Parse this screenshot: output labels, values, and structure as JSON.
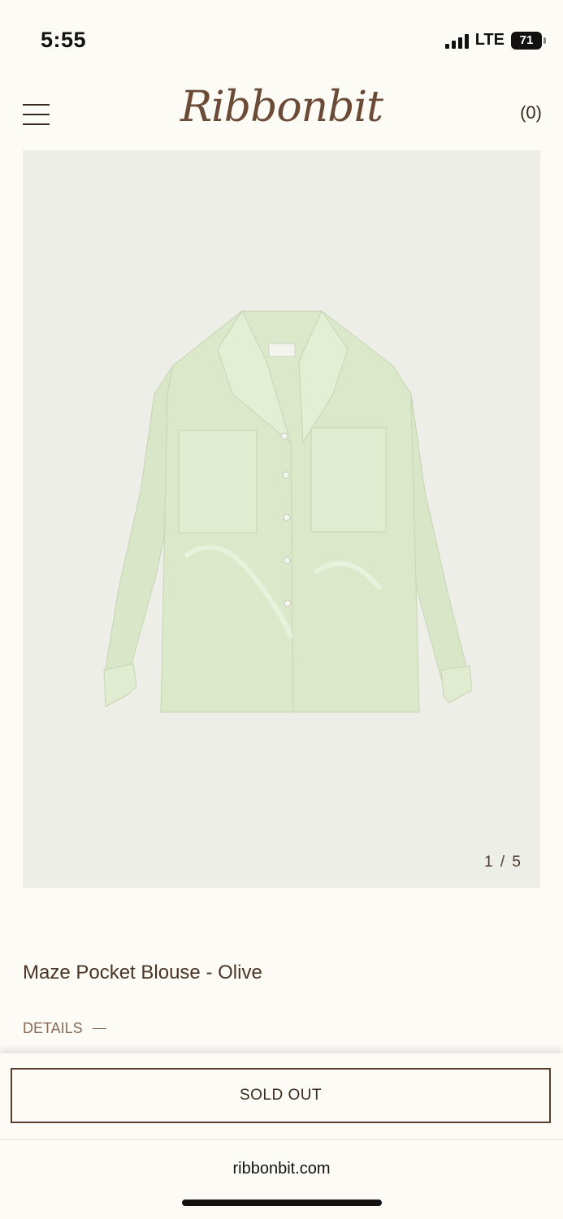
{
  "status_bar": {
    "time": "5:55",
    "network": "LTE",
    "battery": "71"
  },
  "header": {
    "logo": "Ribbonbit",
    "cart_count": "(0)"
  },
  "gallery": {
    "counter": "1 / 5",
    "image": "olive-blouse-photo"
  },
  "product": {
    "title": "Maze Pocket Blouse - Olive",
    "details_label": "DETAILS"
  },
  "actions": {
    "sold_out_label": "SOLD OUT"
  },
  "browser": {
    "url": "ribbonbit.com"
  },
  "colors": {
    "background": "#fcfbf6",
    "brand": "#6b4a36",
    "gallery_bg": "#eeeee8",
    "button_border": "#5a3e2e"
  }
}
